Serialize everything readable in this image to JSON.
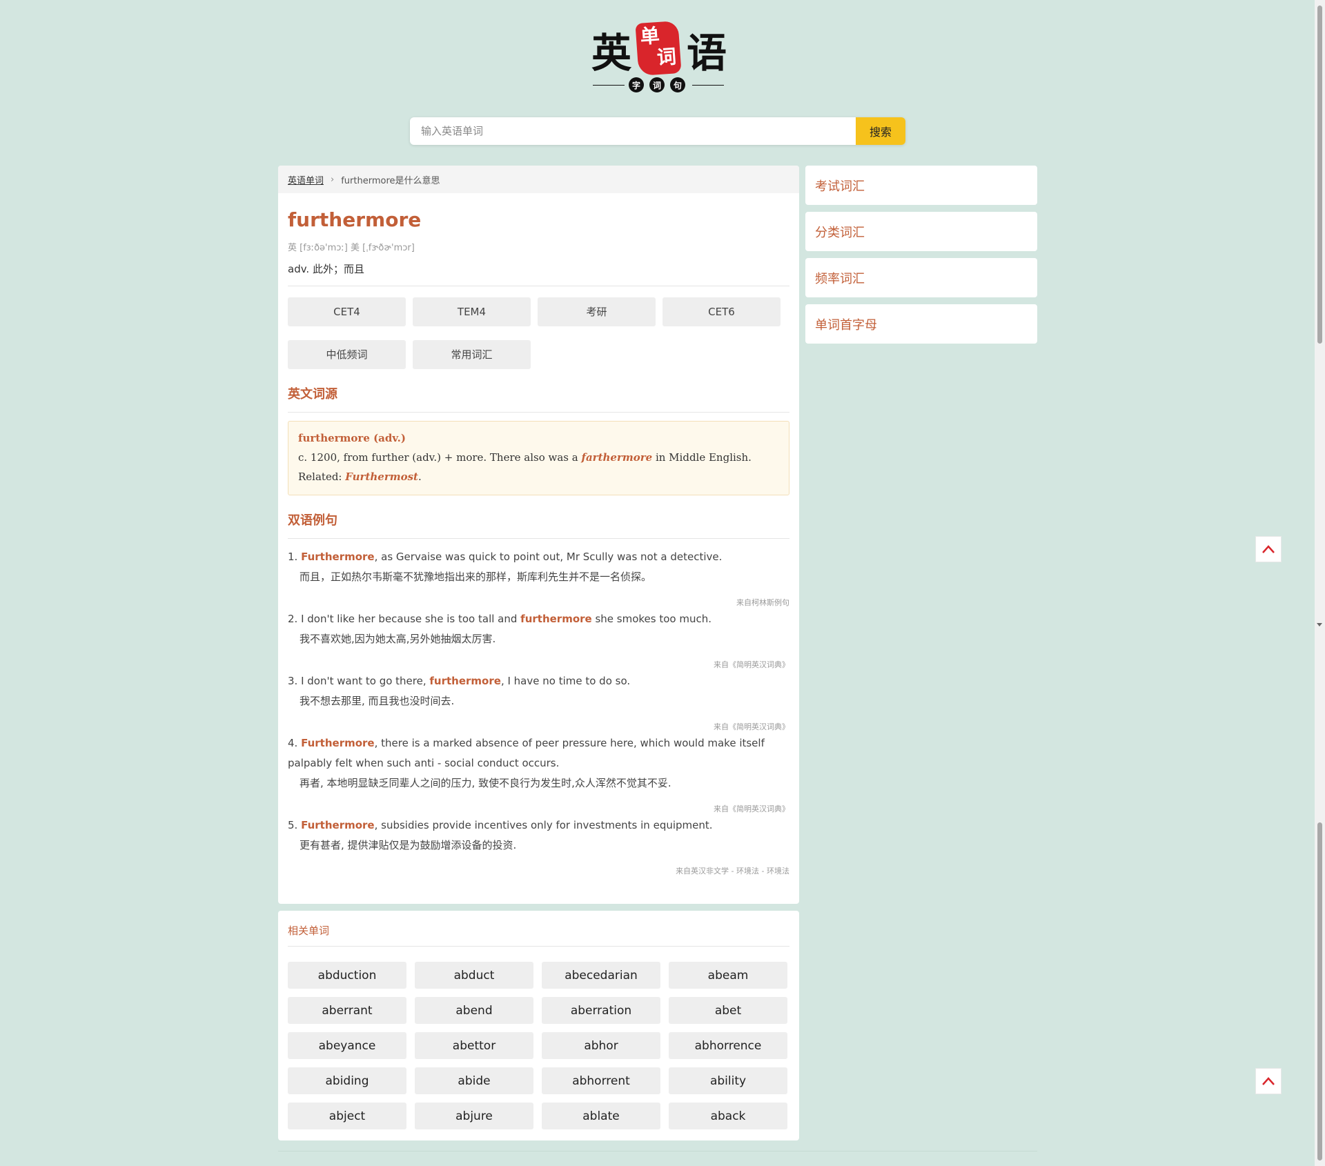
{
  "logo": {
    "char_left": "英",
    "char_right": "语",
    "stamp_chars": [
      "单",
      "词"
    ],
    "sub_chars": [
      "字",
      "词",
      "句"
    ]
  },
  "search": {
    "placeholder": "输入英语单词",
    "value": "",
    "button_label": "搜索"
  },
  "breadcrumb": {
    "home": "英语单词",
    "current": "furthermore是什么意思"
  },
  "word": {
    "title": "furthermore",
    "phonetic": "英 [fɜːðə'mɔː] 美 [ˌfɝðɚ'mɔr]",
    "definition": "adv. 此外；而且",
    "tags": [
      "CET4",
      "TEM4",
      "考研",
      "CET6",
      "中低频词",
      "常用词汇"
    ]
  },
  "etymology": {
    "section_title": "英文词源",
    "head": "furthermore (adv.)",
    "text_before": "c. 1200, from further (adv.) + more. There also was a ",
    "em1": "farthermore",
    "text_middle": " in Middle English. Related: ",
    "em2": "Furthermost",
    "text_after": "."
  },
  "examples": {
    "section_title": "双语例句",
    "items": [
      {
        "num": "1.",
        "pre": "",
        "hl": "Furthermore",
        "post": ", as Gervaise was quick to point out, Mr Scully was not a detective.",
        "zh": "而且，正如热尔韦斯毫不犹豫地指出来的那样，斯库利先生并不是一名侦探。",
        "src": "来自柯林斯例句"
      },
      {
        "num": "2.",
        "pre": "I don't like her because she is too tall and ",
        "hl": "furthermore",
        "post": " she smokes too much.",
        "zh": "我不喜欢她,因为她太高,另外她抽烟太厉害.",
        "src": "来自《简明英汉词典》"
      },
      {
        "num": "3.",
        "pre": "I don't want to go there, ",
        "hl": "furthermore",
        "post": ", I have no time to do so.",
        "zh": "我不想去那里, 而且我也没时间去.",
        "src": "来自《简明英汉词典》"
      },
      {
        "num": "4.",
        "pre": "",
        "hl": "Furthermore",
        "post": ", there is a marked absence of peer pressure here, which would make itself palpably felt when such anti - social conduct occurs.",
        "zh": "再者, 本地明显缺乏同辈人之间的压力, 致使不良行为发生时,众人浑然不觉其不妥.",
        "src": "来自《简明英汉词典》"
      },
      {
        "num": "5.",
        "pre": "",
        "hl": "Furthermore",
        "post": ", subsidies provide incentives only for investments in equipment.",
        "zh": "更有甚者, 提供津贴仅是为鼓励增添设备的投资.",
        "src": "来自英汉非文学 - 环境法 - 环境法"
      }
    ]
  },
  "related": {
    "title": "相关单词",
    "words": [
      "abduction",
      "abduct",
      "abecedarian",
      "abeam",
      "aberrant",
      "abend",
      "aberration",
      "abet",
      "abeyance",
      "abettor",
      "abhor",
      "abhorrence",
      "abiding",
      "abide",
      "abhorrent",
      "ability",
      "abject",
      "abjure",
      "ablate",
      "aback"
    ]
  },
  "sidebar": {
    "items": [
      "考试词汇",
      "分类词汇",
      "频率词汇",
      "单词首字母"
    ]
  },
  "icons": {
    "back_to_top": "chevron-up-icon"
  },
  "colors": {
    "background": "#d3e6e0",
    "accent": "#c25f38",
    "search_button": "#f6c21c",
    "stamp": "#d9252b"
  }
}
